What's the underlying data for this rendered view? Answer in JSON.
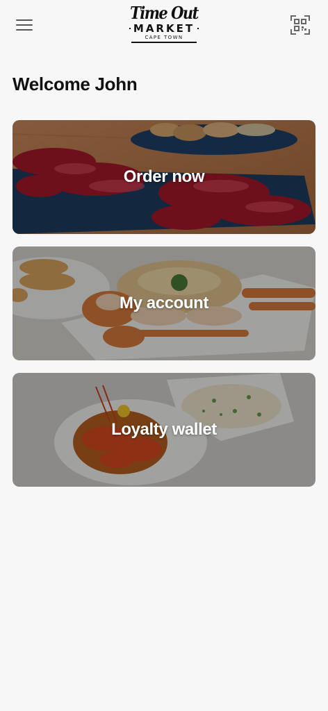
{
  "header": {
    "logo": {
      "line1": "Time Out",
      "line2": "MARKET",
      "line3": "CAPE TOWN"
    },
    "menu_icon": "hamburger-menu-icon",
    "scan_icon": "qr-scan-icon"
  },
  "welcome": "Welcome John",
  "cards": [
    {
      "label": "Order now",
      "image": "cured-ham-platter"
    },
    {
      "label": "My account",
      "image": "crab-dish"
    },
    {
      "label": "Loyalty wallet",
      "image": "prawn-and-rice-dish"
    }
  ],
  "colors": {
    "background": "#f7f7f7",
    "text": "#111111",
    "card_label": "#ffffff"
  }
}
